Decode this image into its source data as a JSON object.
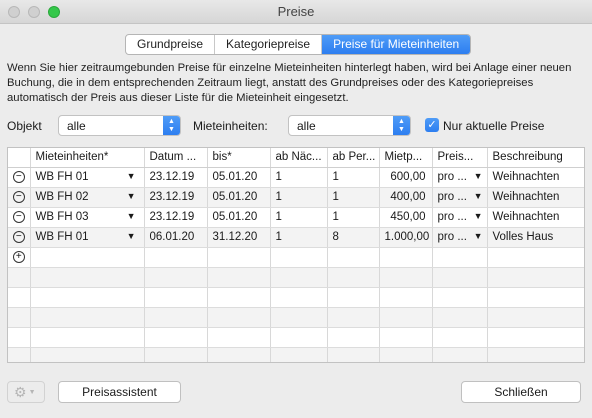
{
  "window": {
    "title": "Preise"
  },
  "tabs": [
    {
      "label": "Grundpreise"
    },
    {
      "label": "Kategoriepreise"
    },
    {
      "label": "Preise für Mieteinheiten",
      "active": true
    }
  ],
  "info_text": "Wenn Sie hier zeitraumgebunden Preise für einzelne Mieteinheiten hinterlegt haben, wird bei Anlage einer neuen Buchung, die in dem entsprechenden Zeitraum liegt, anstatt des Grundpreises oder des Kategoriepreises automatisch der Preis aus dieser Liste für die Mieteinheit eingesetzt.",
  "filters": {
    "objekt_label": "Objekt",
    "objekt_value": "alle",
    "mieteinheiten_label": "Mieteinheiten:",
    "mieteinheiten_value": "alle",
    "aktuelle_label": "Nur aktuelle Preise",
    "aktuelle_checked": true
  },
  "table": {
    "headers": [
      "Mieteinheiten*",
      "Datum ...",
      "bis*",
      "ab Näc...",
      "ab Per...",
      "Mietp...",
      "Preis...",
      "Beschreibung"
    ],
    "rows": [
      {
        "unit": "WB FH 01",
        "from": "23.12.19",
        "to": "05.01.20",
        "nights": "1",
        "persons": "1",
        "price": "600,00",
        "per": "pro ...",
        "desc": "Weihnachten"
      },
      {
        "unit": "WB FH 02",
        "from": "23.12.19",
        "to": "05.01.20",
        "nights": "1",
        "persons": "1",
        "price": "400,00",
        "per": "pro ...",
        "desc": "Weihnachten"
      },
      {
        "unit": "WB FH 03",
        "from": "23.12.19",
        "to": "05.01.20",
        "nights": "1",
        "persons": "1",
        "price": "450,00",
        "per": "pro ...",
        "desc": "Weihnachten"
      },
      {
        "unit": "WB FH 01",
        "from": "06.01.20",
        "to": "31.12.20",
        "nights": "1",
        "persons": "8",
        "price": "1.000,00",
        "per": "pro ...",
        "desc": "Volles Haus"
      }
    ]
  },
  "footer": {
    "assistant_label": "Preisassistent",
    "close_label": "Schließen"
  },
  "icons": {
    "remove": "minus-circle-icon",
    "add": "plus-circle-icon",
    "gear": "gear-icon"
  },
  "colors": {
    "accent": "#2d7ef0"
  }
}
